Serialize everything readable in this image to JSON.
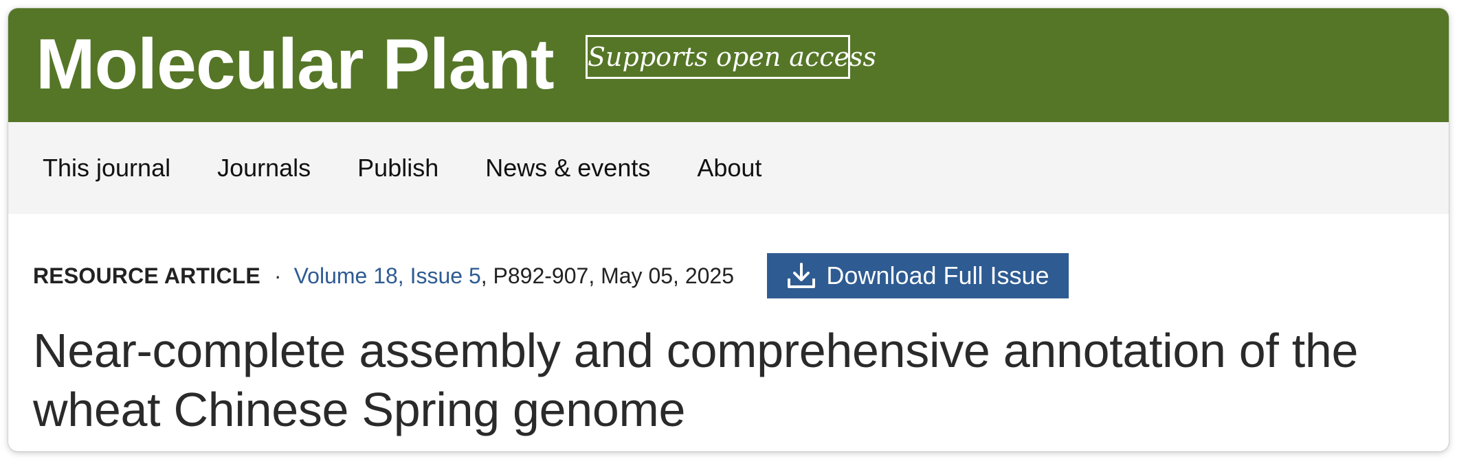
{
  "masthead": {
    "journal_title": "Molecular Plant",
    "open_access_badge": "Supports open access",
    "background_color": "#557627"
  },
  "nav": {
    "items": [
      {
        "label": "This journal"
      },
      {
        "label": "Journals"
      },
      {
        "label": "Publish"
      },
      {
        "label": "News & events"
      },
      {
        "label": "About"
      }
    ]
  },
  "article": {
    "type": "RESOURCE ARTICLE",
    "separator": "·",
    "issue_link": "Volume 18, Issue 5",
    "pages_date": ", P892-907, May 05, 2025",
    "download_button": {
      "label": "Download Full Issue",
      "icon": "download-icon",
      "color": "#2e5b91"
    },
    "title": "Near-complete assembly and comprehensive annotation of the wheat Chinese Spring genome"
  }
}
